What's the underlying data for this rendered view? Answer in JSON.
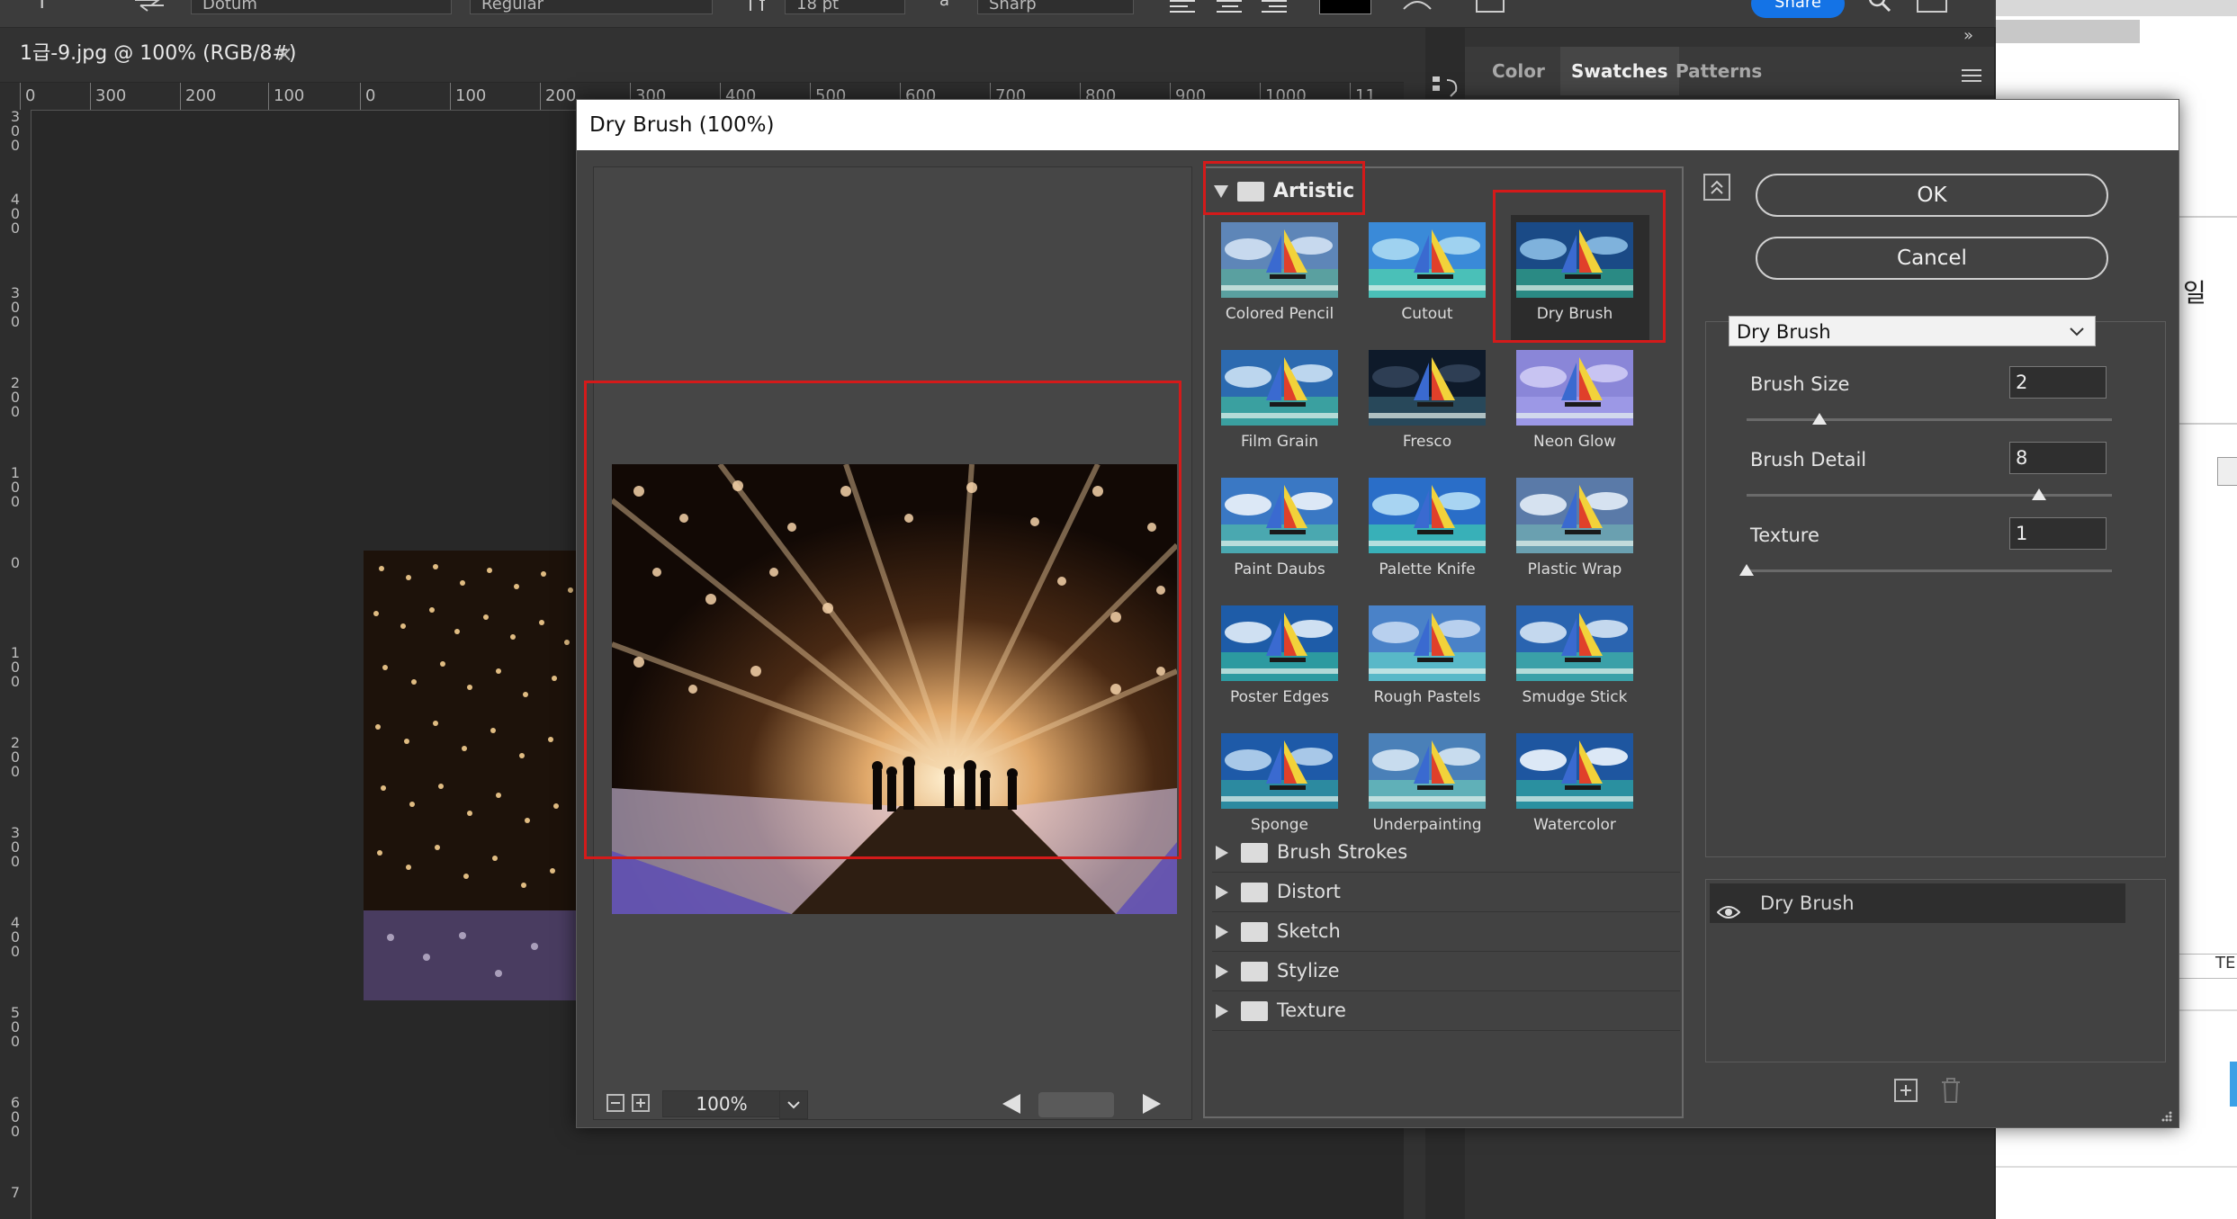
{
  "options_bar": {
    "font_family": "Dotum",
    "font_style": "Regular",
    "font_size": "18 pt",
    "anti_alias": "Sharp",
    "share_label": "Share"
  },
  "document_tab": {
    "title": "1급-9.jpg @ 100% (RGB/8#)",
    "close_glyph": "×"
  },
  "ruler_top_ticks": [
    "0",
    "300",
    "200",
    "100",
    "0",
    "100",
    "200",
    "300",
    "400",
    "500",
    "600",
    "700",
    "800",
    "900",
    "1000",
    "11"
  ],
  "ruler_left_ticks": [
    "300",
    "400",
    "300",
    "200",
    "100",
    "0",
    "100",
    "200",
    "300",
    "400",
    "500",
    "600",
    "7"
  ],
  "panels": {
    "collapse_left": "«",
    "collapse_right": "»",
    "tabs": [
      "Color",
      "Swatches",
      "Patterns"
    ],
    "active_tab": "Swatches",
    "right_page_char": "일",
    "right_page_code": "TE"
  },
  "dialog": {
    "title": "Dry Brush (100%)",
    "preview": {
      "zoom": "100%"
    },
    "gallery": {
      "open_category": "Artistic",
      "filters": [
        {
          "label": "Colored Pencil"
        },
        {
          "label": "Cutout"
        },
        {
          "label": "Dry Brush"
        },
        {
          "label": "Film Grain"
        },
        {
          "label": "Fresco"
        },
        {
          "label": "Neon Glow"
        },
        {
          "label": "Paint Daubs"
        },
        {
          "label": "Palette Knife"
        },
        {
          "label": "Plastic Wrap"
        },
        {
          "label": "Poster Edges"
        },
        {
          "label": "Rough Pastels"
        },
        {
          "label": "Smudge Stick"
        },
        {
          "label": "Sponge"
        },
        {
          "label": "Underpainting"
        },
        {
          "label": "Watercolor"
        }
      ],
      "selected_filter": "Dry Brush",
      "categories": [
        "Brush Strokes",
        "Distort",
        "Sketch",
        "Stylize",
        "Texture"
      ]
    },
    "ok_label": "OK",
    "cancel_label": "Cancel",
    "settings": {
      "filter_select": "Dry Brush",
      "params": [
        {
          "label": "Brush Size",
          "value": "2",
          "level_fraction": 0.2
        },
        {
          "label": "Brush Detail",
          "value": "8",
          "level_fraction": 0.8
        },
        {
          "label": "Texture",
          "value": "1",
          "level_fraction": 0.0
        }
      ]
    },
    "effect_layers": [
      {
        "name": "Dry Brush",
        "visible": true
      }
    ],
    "colors": {
      "highlight_box": "#d41a1a",
      "dialog_bg": "#424242",
      "share_blue": "#1473e6"
    }
  }
}
